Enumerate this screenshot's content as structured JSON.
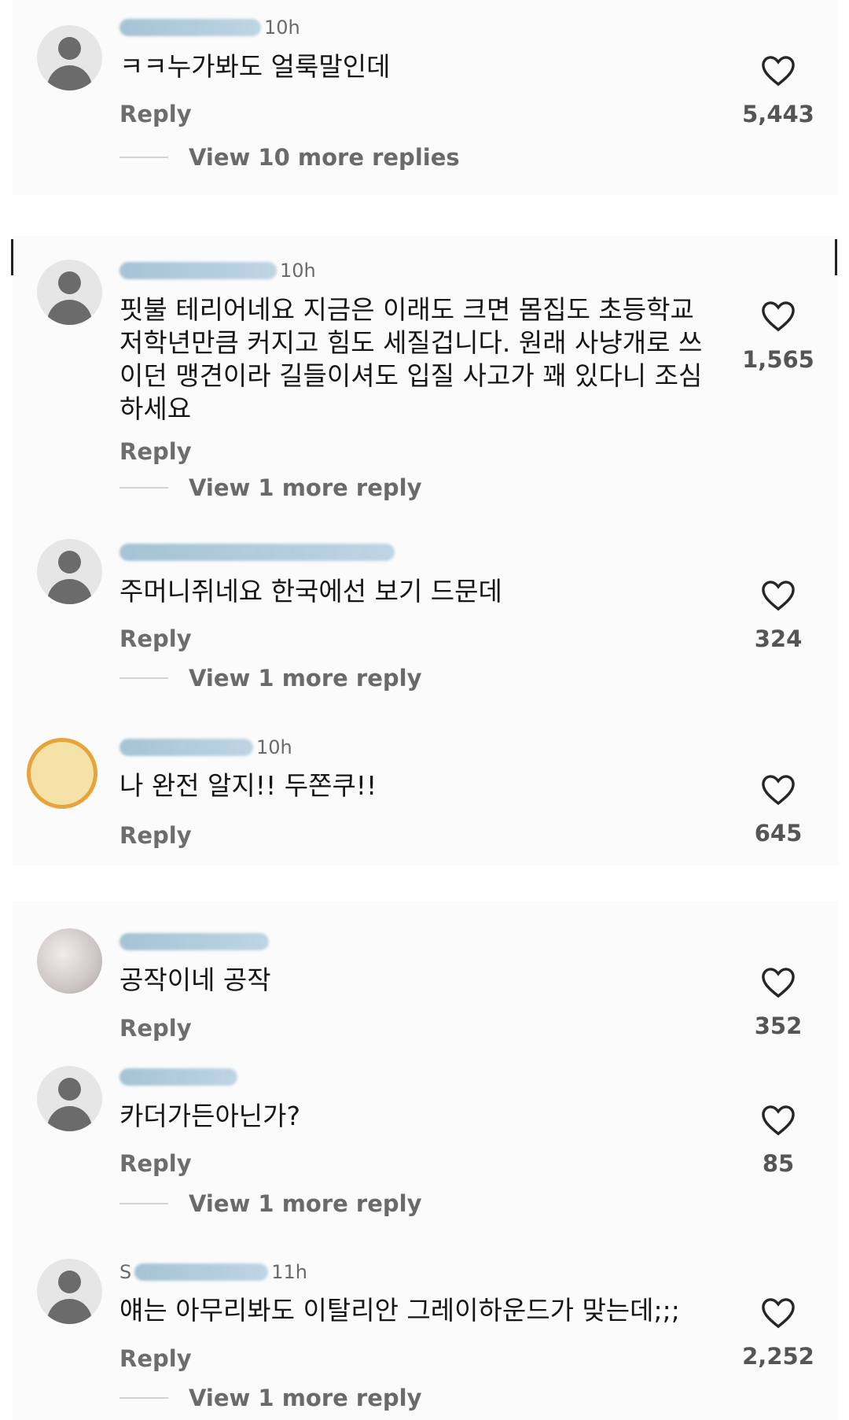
{
  "comments": [
    {
      "time": "10h",
      "text": "ㅋㅋ누가봐도 얼룩말인데",
      "reply": "Reply",
      "likes": "5,443",
      "view_more": "View 10 more replies"
    },
    {
      "time": "10h",
      "text": "핏불 테리어네요 지금은 이래도 크면 몸집도 초등학교 저학년만큼 커지고 힘도 세질겁니다. 원래 사냥개로 쓰이던 맹견이라 길들이셔도 입질 사고가 꽤 있다니 조심하세요",
      "reply": "Reply",
      "likes": "1,565",
      "view_more": "View 1 more reply"
    },
    {
      "time": "",
      "text": "주머니쥐네요 한국에선 보기 드문데",
      "reply": "Reply",
      "likes": "324",
      "view_more": "View 1 more reply"
    },
    {
      "time": "10h",
      "text": "나 완전 알지!! 두쫀쿠!!",
      "reply": "Reply",
      "likes": "645"
    },
    {
      "time": "",
      "text": "공작이네 공작",
      "reply": "Reply",
      "likes": "352"
    },
    {
      "time": "",
      "text": "카더가든아닌가?",
      "reply": "Reply",
      "likes": "85",
      "view_more": "View 1 more reply"
    },
    {
      "name_prefix": "S",
      "time": "11h",
      "text": "얘는 아무리봐도 이탈리안 그레이하운드가 맞는데;;;",
      "reply": "Reply",
      "likes": "2,252",
      "view_more": "View 1 more reply"
    }
  ],
  "colors": {
    "background": "#ffffff",
    "panel": "#fbfbfb",
    "text": "#161616",
    "secondary": "#6d6d6d",
    "scribble": "#9cc0d6"
  },
  "icons": {
    "like": "heart-outline-icon",
    "avatar": "default-user-avatar-icon"
  }
}
